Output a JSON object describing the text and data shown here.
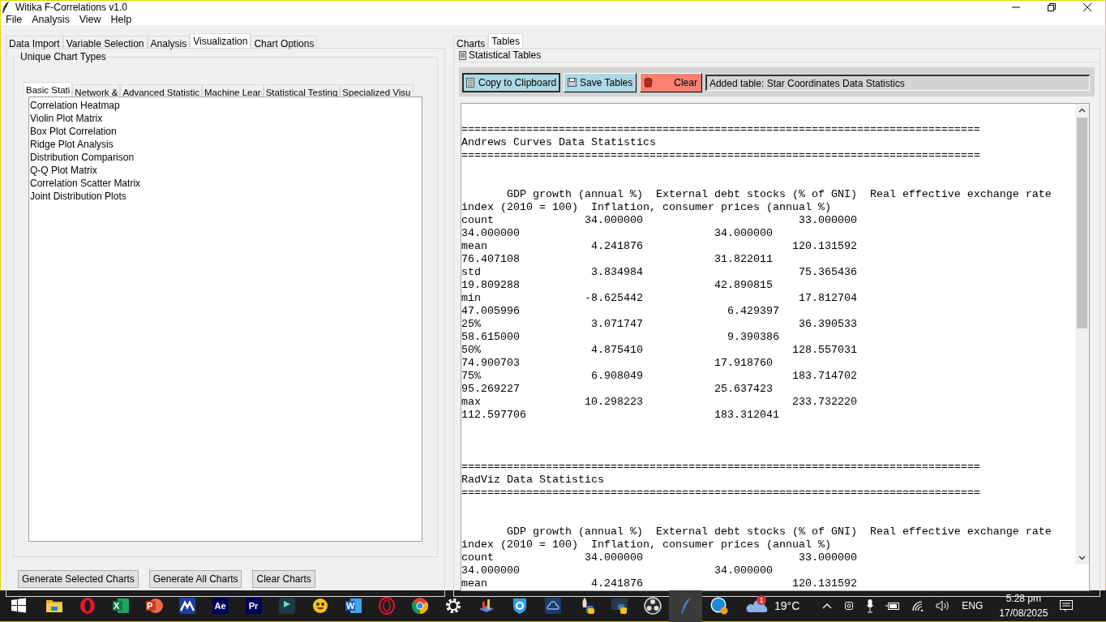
{
  "window": {
    "title": "Witika F-Correlations v1.0"
  },
  "menu": [
    "File",
    "Analysis",
    "View",
    "Help"
  ],
  "main_tabs": [
    {
      "label": "Data Import",
      "selected": false
    },
    {
      "label": "Variable Selection",
      "selected": false
    },
    {
      "label": "Analysis",
      "selected": false
    },
    {
      "label": "Visualization",
      "selected": true
    },
    {
      "label": "Chart Options",
      "selected": false
    }
  ],
  "chart_types": {
    "title": "Unique Chart Types",
    "tabs": [
      {
        "label": "Basic Stati",
        "selected": true
      },
      {
        "label": "Network &",
        "selected": false
      },
      {
        "label": "Advanced Statistic",
        "selected": false
      },
      {
        "label": "Machine Lear",
        "selected": false
      },
      {
        "label": "Statistical Testing",
        "selected": false
      },
      {
        "label": "Specialized Visu",
        "selected": false
      }
    ],
    "items": [
      {
        "label": "Correlation Heatmap",
        "selected": false
      },
      {
        "label": "Violin Plot Matrix",
        "selected": false
      },
      {
        "label": "Box Plot Correlation",
        "selected": false
      },
      {
        "label": "Ridge Plot Analysis",
        "selected": false
      },
      {
        "label": "Distribution Comparison",
        "selected": false
      },
      {
        "label": "Q-Q Plot Matrix",
        "selected": false
      },
      {
        "label": "Correlation Scatter Matrix",
        "selected": false
      },
      {
        "label": "Joint Distribution Plots",
        "selected": false
      }
    ]
  },
  "buttons": [
    "Generate Selected Charts",
    "Generate All Charts",
    "Clear Charts"
  ],
  "right_tabs": [
    {
      "label": "Charts",
      "selected": false
    },
    {
      "label": "Tables",
      "selected": true
    }
  ],
  "tables_panel": {
    "title": "Statistical Tables",
    "toolbar": [
      {
        "label": "Copy to Clipboard",
        "kind": "copy"
      },
      {
        "label": "Save Tables",
        "kind": "save"
      },
      {
        "label": "Clear",
        "kind": "clear"
      }
    ],
    "status": "Added table: Star Coordinates Data Statistics",
    "sections": [
      {
        "rule_top": "================================================================================",
        "title": "Andrews Curves Data Statistics",
        "rule_bottom": "================================================================================",
        "lines": [
          "       GDP growth (annual %)  External debt stocks (% of GNI)  Real effective exchange rate",
          "index (2010 = 100)  Inflation, consumer prices (annual %)",
          "count              34.000000                        33.000000",
          "34.000000                              34.000000",
          "mean                4.241876                       120.131592",
          "76.407108                              31.822011",
          "std                 3.834984                        75.365436",
          "19.809288                              42.890815",
          "min                -8.625442                        17.812704",
          "47.005996                                6.429397",
          "25%                 3.071747                        36.390533",
          "58.615000                                9.390386",
          "50%                 4.875410                       128.557031",
          "74.900703                              17.918760",
          "75%                 6.908049                       183.714702",
          "95.269227                              25.637423",
          "max                10.298223                       233.732220",
          "112.597706                             183.312041"
        ]
      },
      {
        "rule_top": "================================================================================",
        "title": "RadViz Data Statistics",
        "rule_bottom": "================================================================================",
        "lines": [
          "       GDP growth (annual %)  External debt stocks (% of GNI)  Real effective exchange rate",
          "index (2010 = 100)  Inflation, consumer prices (annual %)",
          "count              34.000000                        33.000000",
          "34.000000                              34.000000",
          "mean                4.241876                       120.131592"
        ]
      }
    ]
  },
  "taskbar": {
    "apps": [
      {
        "kind": "start",
        "selected": false
      },
      {
        "kind": "folder",
        "selected": false
      },
      {
        "kind": "opera",
        "selected": false
      },
      {
        "kind": "excel",
        "glyph": "X",
        "selected": false
      },
      {
        "kind": "powerpoint",
        "glyph": "P",
        "selected": false
      },
      {
        "kind": "mountain",
        "selected": false
      },
      {
        "kind": "aftereffects",
        "glyph": "Ae",
        "selected": false
      },
      {
        "kind": "premiere",
        "glyph": "Pr",
        "selected": false
      },
      {
        "kind": "filmora",
        "selected": false
      },
      {
        "kind": "smiley",
        "selected": false
      },
      {
        "kind": "word",
        "glyph": "W",
        "selected": false
      },
      {
        "kind": "operagx",
        "selected": false
      },
      {
        "kind": "chrome",
        "selected": false
      },
      {
        "kind": "gear",
        "selected": false
      },
      {
        "kind": "chart",
        "selected": false
      },
      {
        "kind": "shield",
        "selected": false
      },
      {
        "kind": "cloud",
        "selected": false
      },
      {
        "kind": "rocket",
        "selected": false
      },
      {
        "kind": "python",
        "selected": false
      },
      {
        "kind": "obs",
        "selected": false
      },
      {
        "kind": "feather",
        "selected": true
      },
      {
        "kind": "help",
        "selected": false
      }
    ],
    "weather": {
      "badge": "1",
      "temperature": "19°C"
    },
    "language": "ENG",
    "time": "5:28 pm",
    "date": "17/08/2025"
  }
}
